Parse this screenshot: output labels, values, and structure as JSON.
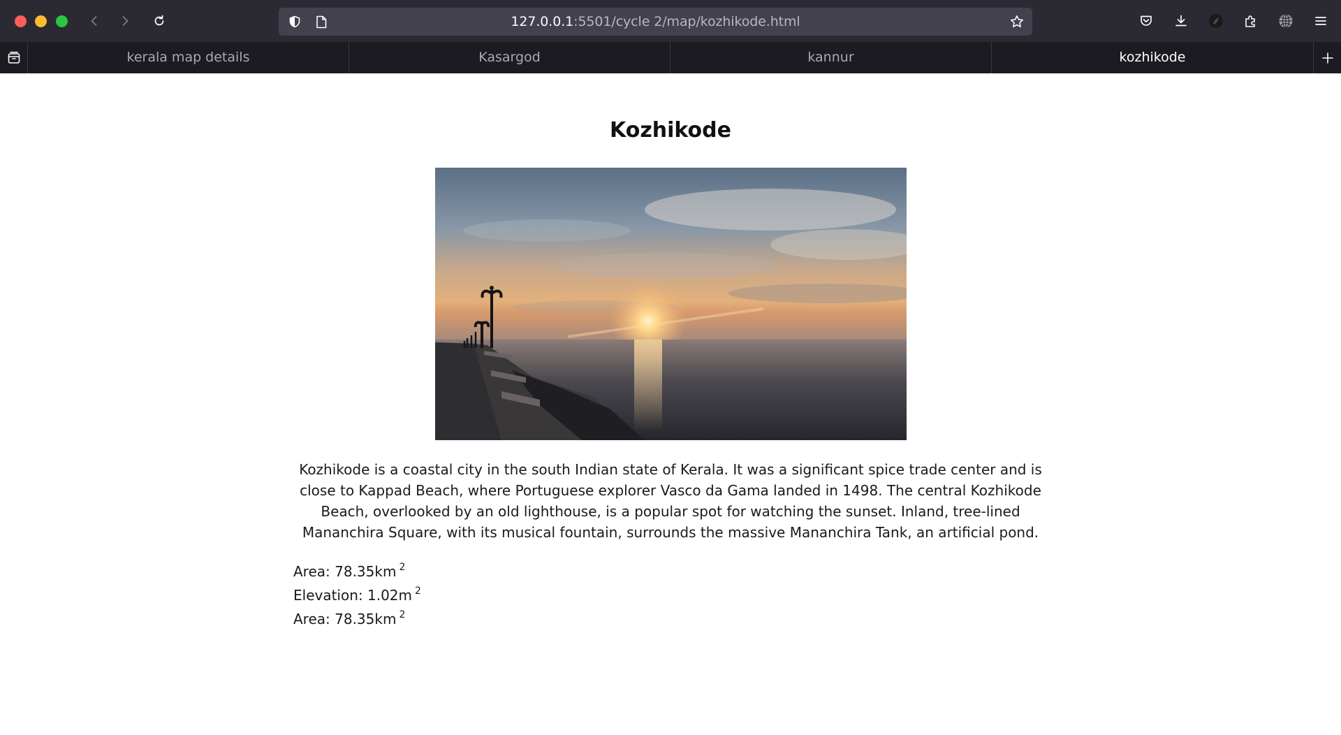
{
  "browser": {
    "url_host": "127.0.0.1",
    "url_path": ":5501/cycle 2/map/kozhikode.html",
    "icons": [
      "chevron-left-icon",
      "chevron-right-icon",
      "reload-icon",
      "shield-icon",
      "page-icon",
      "star-icon",
      "pocket-icon",
      "download-icon",
      "profile-icon",
      "extensions-icon",
      "globe-icon",
      "menu-icon",
      "tab-list-icon",
      "plus-icon"
    ],
    "tabs": [
      {
        "label": "kerala map details",
        "active": false
      },
      {
        "label": "Kasargod",
        "active": false
      },
      {
        "label": "kannur",
        "active": false
      },
      {
        "label": "kozhikode",
        "active": true
      }
    ],
    "colors": {
      "toolbar": "#2b2a33",
      "tabstrip": "#1c1b22",
      "urlbar": "#42414d",
      "close": "#fe5f57",
      "minimize": "#febc2e",
      "maximize": "#28c840"
    }
  },
  "page": {
    "title": "Kozhikode",
    "description": "Kozhikode is a coastal city in the south Indian state of Kerala. It was a significant spice trade center and is close to Kappad Beach, where Portuguese explorer Vasco da Gama landed in 1498. The central Kozhikode Beach, overlooked by an old lighthouse, is a popular spot for watching the sunset. Inland, tree-lined Mananchira Square, with its musical fountain, surrounds the massive Mananchira Tank, an artificial pond.",
    "facts": [
      {
        "label": "Area: 78.35km",
        "sup": "2"
      },
      {
        "label": "Elevation: 1.02m",
        "sup": "2"
      },
      {
        "label": "Area: 78.35km",
        "sup": "2"
      }
    ]
  }
}
